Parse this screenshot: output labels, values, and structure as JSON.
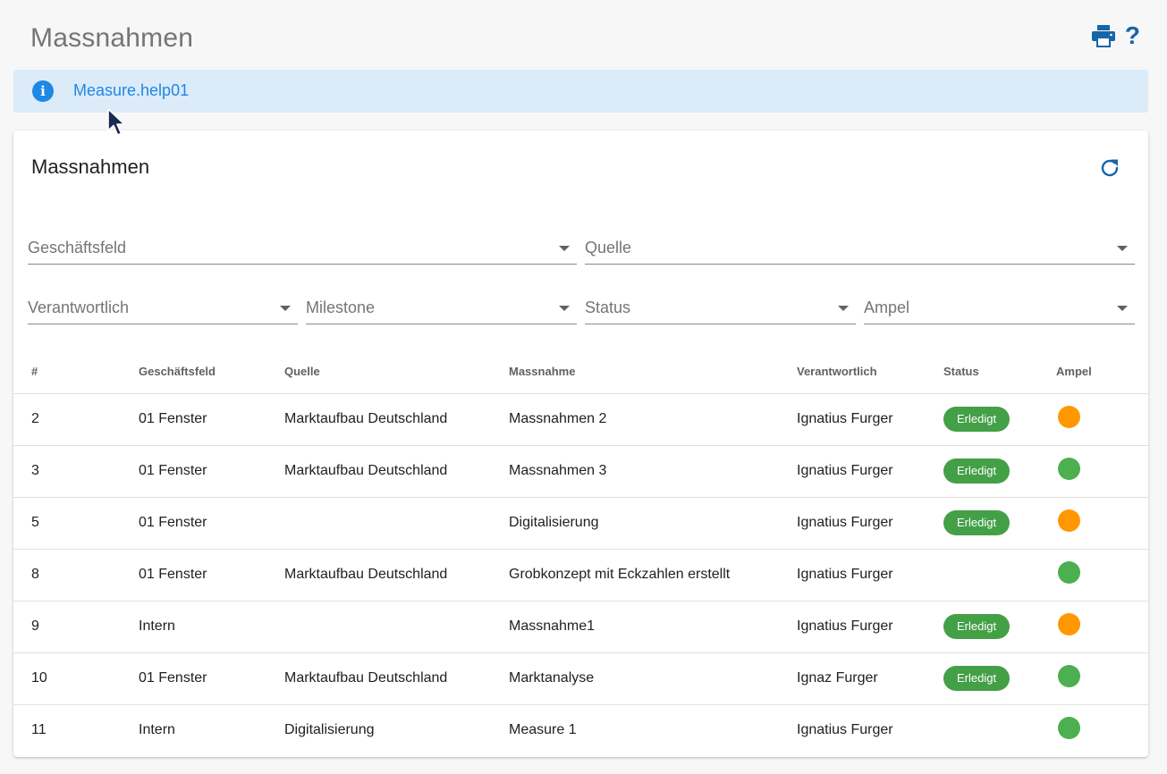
{
  "page": {
    "title": "Massnahmen",
    "print_icon": "printer-icon",
    "help_label": "?"
  },
  "banner": {
    "icon": "info-icon",
    "icon_glyph": "i",
    "text": "Measure.help01"
  },
  "card": {
    "title": "Massnahmen",
    "refresh_icon": "refresh-icon"
  },
  "filters": {
    "geschaeftsfeld": "Geschäftsfeld",
    "quelle": "Quelle",
    "verantwortlich": "Verantwortlich",
    "milestone": "Milestone",
    "status": "Status",
    "ampel": "Ampel"
  },
  "table": {
    "headers": [
      "#",
      "Geschäftsfeld",
      "Quelle",
      "Massnahme",
      "Verantwortlich",
      "Status",
      "Ampel"
    ],
    "rows": [
      {
        "id": "2",
        "field": "01 Fenster",
        "source": "Marktaufbau Deutschland",
        "measure": "Massnahmen 2",
        "owner": "Ignatius Furger",
        "status": "Erledigt",
        "ampel": "#ff9800"
      },
      {
        "id": "3",
        "field": "01 Fenster",
        "source": "Marktaufbau Deutschland",
        "measure": "Massnahmen 3",
        "owner": "Ignatius Furger",
        "status": "Erledigt",
        "ampel": "#4caf50"
      },
      {
        "id": "5",
        "field": "01 Fenster",
        "source": "",
        "measure": "Digitalisierung",
        "owner": "Ignatius Furger",
        "status": "Erledigt",
        "ampel": "#ff9800"
      },
      {
        "id": "8",
        "field": "01 Fenster",
        "source": "Marktaufbau Deutschland",
        "measure": "Grobkonzept mit Eckzahlen erstellt",
        "owner": "Ignatius Furger",
        "status": "",
        "ampel": "#4caf50"
      },
      {
        "id": "9",
        "field": "Intern",
        "source": "",
        "measure": "Massnahme1",
        "owner": "Ignatius Furger",
        "status": "Erledigt",
        "ampel": "#ff9800"
      },
      {
        "id": "10",
        "field": "01 Fenster",
        "source": "Marktaufbau Deutschland",
        "measure": "Marktanalyse",
        "owner": "Ignaz Furger",
        "status": "Erledigt",
        "ampel": "#4caf50"
      },
      {
        "id": "11",
        "field": "Intern",
        "source": "Digitalisierung",
        "measure": "Measure 1",
        "owner": "Ignatius Furger",
        "status": "",
        "ampel": "#4caf50"
      }
    ]
  },
  "colors": {
    "accent": "#1565a8",
    "info": "#1e88e5",
    "done_badge": "#43a047",
    "ampel_green": "#4caf50",
    "ampel_orange": "#ff9800"
  }
}
